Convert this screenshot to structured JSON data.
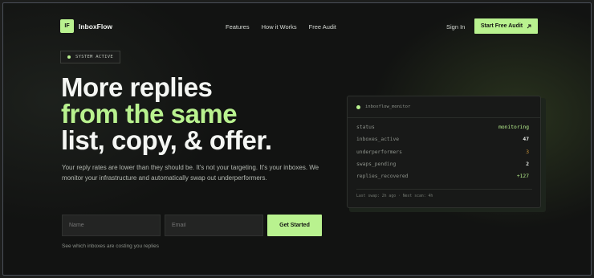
{
  "nav": {
    "logo_initials": "IF",
    "brand": "InboxFlow",
    "links": [
      "Features",
      "How it Works",
      "Free Audit"
    ],
    "signin": "Sign In",
    "cta": "Start Free Audit",
    "cta_icon": "arrow-up-right-icon"
  },
  "status_chip": {
    "label": "SYSTEM ACTIVE"
  },
  "hero": {
    "line1": "More replies",
    "line2": "from the same",
    "line3": "list, copy, & offer.",
    "description": "Your reply rates are lower than they should be. It's not your targeting. It's your inboxes. We monitor your infrastructure and automatically swap out underperformers."
  },
  "form": {
    "name_placeholder": "Name",
    "email_placeholder": "Email",
    "submit": "Get Started",
    "note": "See which inboxes are costing you replies"
  },
  "monitor": {
    "title": "inboxflow_monitor",
    "rows": [
      {
        "key": "status",
        "value": "monitoring"
      },
      {
        "key": "inboxes_active",
        "value": "47"
      },
      {
        "key": "underperformers",
        "value": "3"
      },
      {
        "key": "swaps_pending",
        "value": "2"
      },
      {
        "key": "replies_recovered",
        "value": "+127"
      }
    ],
    "footer": "Last swap: 2h ago · Next scan: 4h"
  },
  "colors": {
    "accent": "#b9f28f",
    "background": "#121312",
    "warning": "#d69a3a"
  }
}
